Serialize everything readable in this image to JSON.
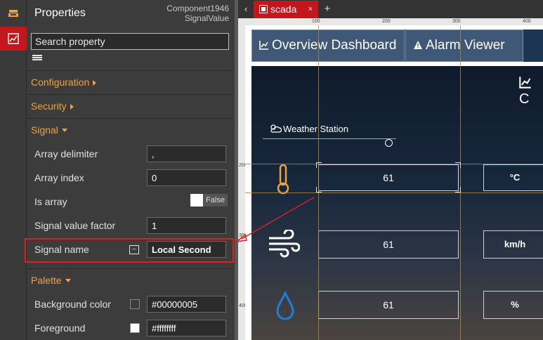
{
  "rail": {
    "icons": [
      "panel-stack-icon",
      "component-chart-icon"
    ]
  },
  "properties": {
    "title": "Properties",
    "component_id": "Component1946",
    "component_type": "SignalValue",
    "search_placeholder": "Search property",
    "sections": {
      "configuration": "Configuration",
      "security": "Security",
      "signal": "Signal",
      "palette": "Palette"
    },
    "fields": {
      "array_delimiter": {
        "label": "Array delimiter",
        "value": ","
      },
      "array_index": {
        "label": "Array index",
        "value": "0"
      },
      "is_array": {
        "label": "Is array",
        "value": "False"
      },
      "signal_value_factor": {
        "label": "Signal value factor",
        "value": "1"
      },
      "signal_name": {
        "label": "Signal name",
        "value": "Local Second"
      },
      "background_color": {
        "label": "Background color",
        "value": "#00000005"
      },
      "foreground": {
        "label": "Foreground",
        "value": "#ffffffff"
      }
    }
  },
  "tabs": {
    "active": "scada",
    "close": "×",
    "add": "+",
    "back": "‹"
  },
  "ruler": {
    "top": [
      "100",
      "200",
      "300",
      "400"
    ],
    "left": [
      "200",
      "300",
      "400"
    ]
  },
  "canvas": {
    "nav": {
      "overview": "Overview Dashboard",
      "alarm": "Alarm Viewer",
      "partial": "C"
    },
    "weather_station": "Weather Station",
    "rows": [
      {
        "icon": "thermometer-icon",
        "value": "61",
        "unit": "°C"
      },
      {
        "icon": "wind-icon",
        "value": "61",
        "unit": "km/h"
      },
      {
        "icon": "water-drop-icon",
        "value": "61",
        "unit": "%"
      }
    ]
  },
  "colors": {
    "accent": "#c4161c",
    "section": "#f0a23c",
    "highlight": "#e0201f"
  }
}
